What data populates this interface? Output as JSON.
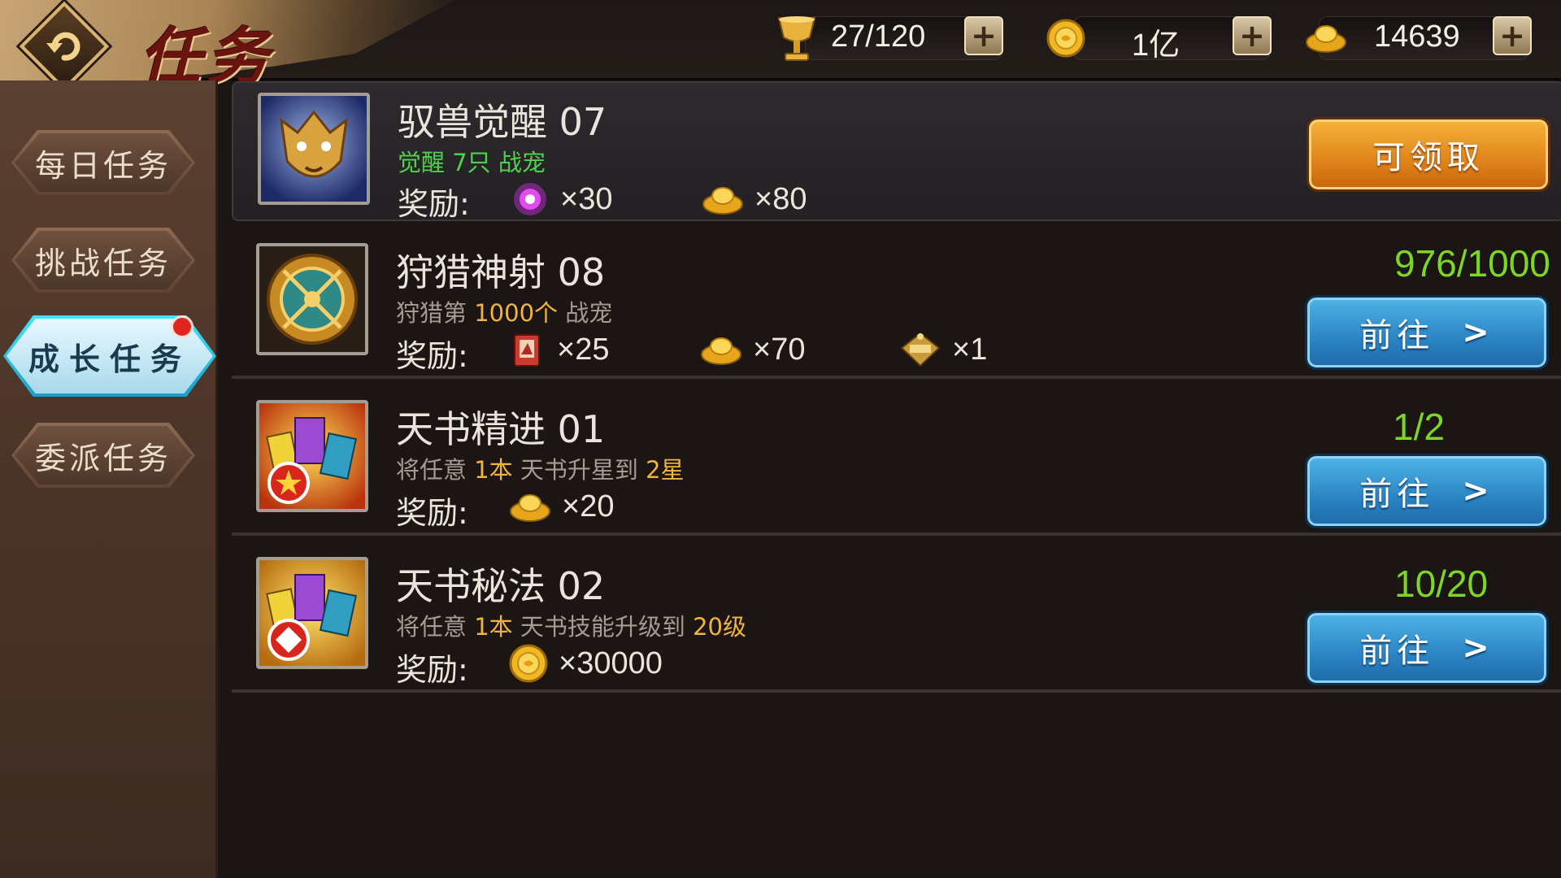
{
  "header": {
    "title": "任务",
    "back_icon": "back-arrow-icon",
    "resources": [
      {
        "icon": "stamina-cup-icon",
        "value": "27/120"
      },
      {
        "icon": "gold-coin-icon",
        "value": "1亿"
      },
      {
        "icon": "gold-ingot-icon",
        "value": "14639"
      }
    ],
    "plus_symbol": "+"
  },
  "sidebar": {
    "tabs": [
      {
        "label": "每日任务",
        "active": false
      },
      {
        "label": "挑战任务",
        "active": false
      },
      {
        "label": "成长任务",
        "active": true,
        "badge": true
      },
      {
        "label": "委派任务",
        "active": false
      }
    ]
  },
  "tasks": [
    {
      "name": "驭兽觉醒 07",
      "desc_parts": [
        "觉醒 7只 战宠"
      ],
      "desc_color": "green",
      "reward_label": "奖励:",
      "rewards": [
        {
          "icon": "purple-orb-icon",
          "qty": "×30"
        },
        {
          "icon": "gold-ingot-icon",
          "qty": "×80"
        }
      ],
      "progress": "",
      "button": {
        "label": "可领取",
        "style": "orange"
      }
    },
    {
      "name": "狩猎神射 08",
      "desc_parts": [
        "狩猎第 ",
        "1000个",
        " 战宠"
      ],
      "reward_label": "奖励:",
      "rewards": [
        {
          "icon": "scroll-card-icon",
          "qty": "×25"
        },
        {
          "icon": "gold-ingot-icon",
          "qty": "×70"
        },
        {
          "icon": "title-badge-icon",
          "qty": "×1"
        }
      ],
      "progress": "976/1000",
      "button": {
        "label": "前往",
        "style": "blue"
      }
    },
    {
      "name": "天书精进 01",
      "desc_parts": [
        "将任意 ",
        "1本",
        " 天书升星到 ",
        "2星"
      ],
      "reward_label": "奖励:",
      "rewards": [
        {
          "icon": "gold-ingot-icon",
          "qty": "×20"
        }
      ],
      "progress": "1/2",
      "button": {
        "label": "前往",
        "style": "blue"
      }
    },
    {
      "name": "天书秘法 02",
      "desc_parts": [
        "将任意 ",
        "1本",
        " 天书技能升级到 ",
        "20级"
      ],
      "reward_label": "奖励:",
      "rewards": [
        {
          "icon": "gold-coin-icon",
          "qty": "×30000"
        }
      ],
      "progress": "10/20",
      "button": {
        "label": "前往",
        "style": "blue"
      }
    }
  ],
  "colors": {
    "progress_green": "#7dd624",
    "highlight_orange": "#f2b43c",
    "desc_green": "#4fd24b",
    "active_tab_cyan": "#3fe6ff"
  }
}
